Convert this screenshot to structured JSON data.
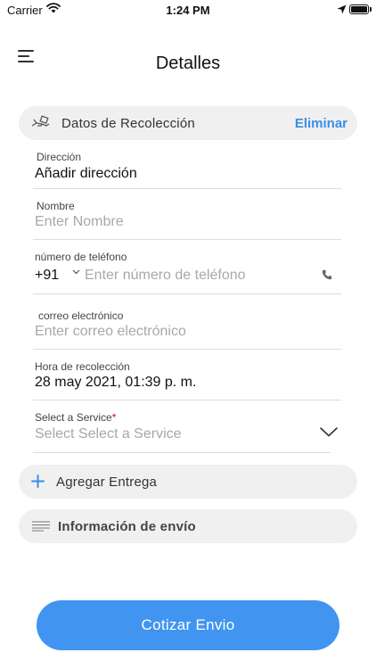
{
  "status_bar": {
    "carrier": "Carrier",
    "time": "1:24 PM",
    "battery_level": 1.0
  },
  "header": {
    "title": "Detalles"
  },
  "pickup_section": {
    "label": "Datos de Recolección",
    "remove_label": "Eliminar",
    "icon": "hand-package-icon"
  },
  "fields": {
    "address": {
      "label": "Dirección",
      "value": "Añadir dirección"
    },
    "name": {
      "label": "Nombre",
      "placeholder": "Enter  Nombre"
    },
    "phone": {
      "label": "número de teléfono",
      "country_code": "+91",
      "placeholder": "Enter número de teléfono"
    },
    "email": {
      "label": "correo electrónico",
      "placeholder": "Enter  correo electrónico"
    },
    "pickup_time": {
      "label": "Hora de recolección",
      "value": "28 may 2021, 01:39 p. m."
    },
    "service": {
      "label": "Select a Service",
      "required_mark": "*",
      "placeholder": "Select Select a Service"
    }
  },
  "delivery_section": {
    "label": "Agregar Entrega",
    "icon": "plus-icon"
  },
  "shipping_section": {
    "label": "Información de envío",
    "icon": "lines-icon"
  },
  "primary_action": {
    "label": "Cotizar Envio"
  },
  "colors": {
    "accent": "#4195f0",
    "link": "#3a8ee6",
    "section_bg": "#f0f0f0",
    "required": "#d0021b"
  }
}
